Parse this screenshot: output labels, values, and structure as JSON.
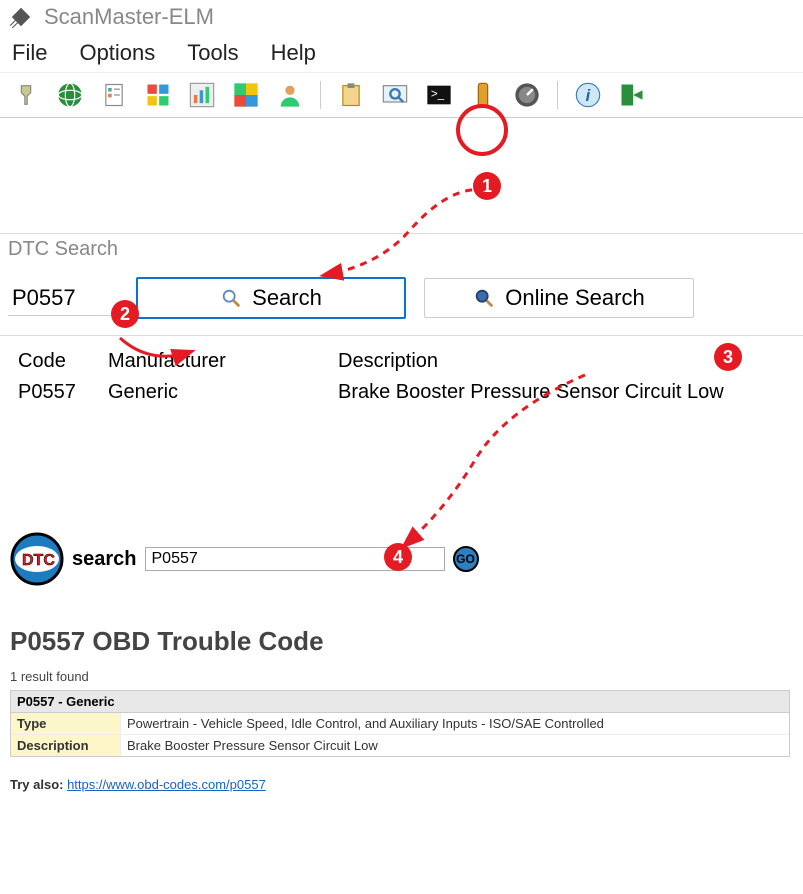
{
  "title": "ScanMaster-ELM",
  "menubar": [
    "File",
    "Options",
    "Tools",
    "Help"
  ],
  "dtc_panel": {
    "title": "DTC Search",
    "code_value": "P0557",
    "search_label": "Search",
    "online_label": "Online Search",
    "columns": {
      "code": "Code",
      "man": "Manufacturer",
      "desc": "Description"
    },
    "row": {
      "code": "P0557",
      "man": "Generic",
      "desc": "Brake Booster Pressure Sensor Circuit Low"
    }
  },
  "web": {
    "logo_text": "search",
    "input_value": "P0557",
    "go_label": "GO",
    "heading": "P0557 OBD Trouble Code",
    "results_count": "1 result found",
    "box_head": "P0557 - Generic",
    "type_label": "Type",
    "type_value": "Powertrain - Vehicle Speed, Idle Control, and Auxiliary Inputs - ISO/SAE Controlled",
    "desc_label": "Description",
    "desc_value": "Brake Booster Pressure Sensor Circuit Low",
    "try_prefix": "Try also: ",
    "try_link": "https://www.obd-codes.com/p0557"
  },
  "badges": {
    "b1": "1",
    "b2": "2",
    "b3": "3",
    "b4": "4"
  }
}
